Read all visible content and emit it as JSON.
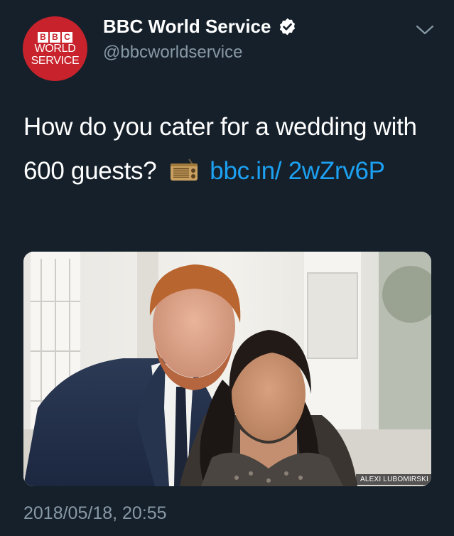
{
  "account": {
    "display_name": "BBC World Service",
    "handle": "@bbcworldservice",
    "verified": true,
    "avatar": {
      "blocks": [
        "B",
        "B",
        "C"
      ],
      "line1": "WORLD",
      "line2": "SERVICE",
      "color": "#c8232c"
    }
  },
  "menu": {
    "icon": "chevron-down-icon"
  },
  "tweet": {
    "text_before": "How do you cater for a wedding with 600 guests?",
    "emoji": "radio-emoji",
    "link_text": "bbc.in/ 2wZrv6P",
    "link_color": "#1da1f2"
  },
  "media": {
    "credit": "ALEXI LUBOMIRSKI"
  },
  "timestamp": "2018/05/18, 20:55",
  "colors": {
    "background": "#15202b",
    "text": "#ffffff",
    "secondary": "#8899a6"
  }
}
